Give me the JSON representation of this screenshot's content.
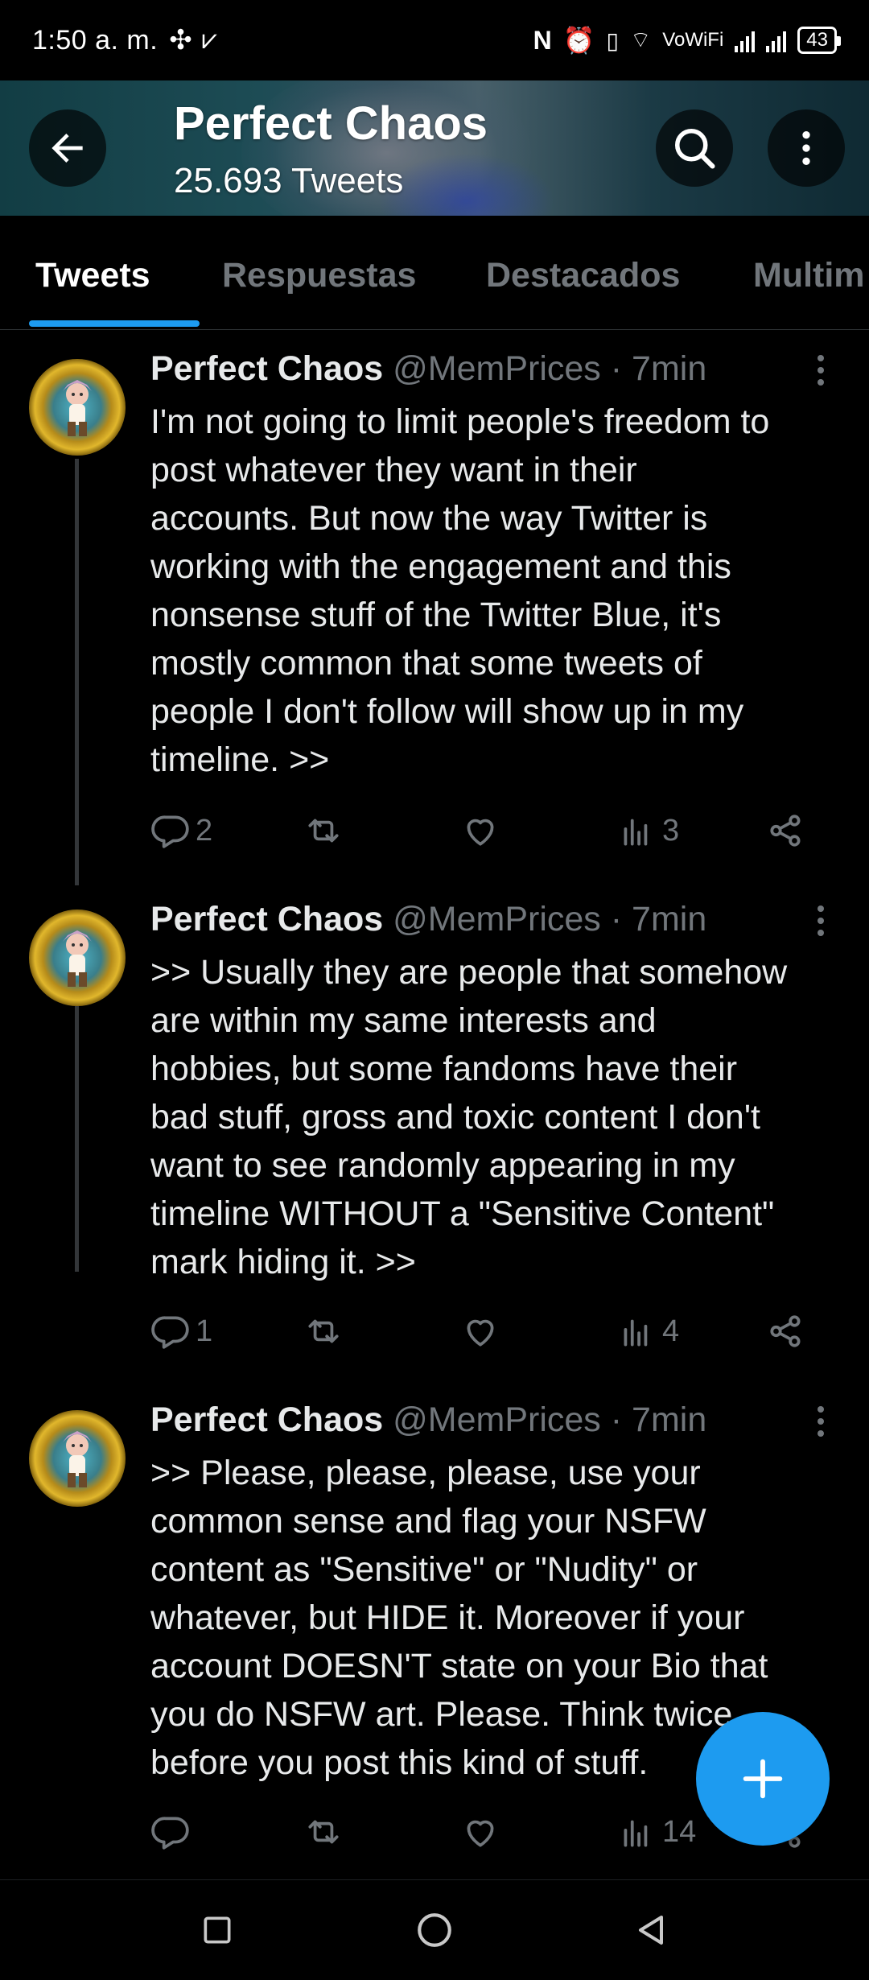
{
  "status_bar": {
    "time": "1:50 a. m.",
    "left_icons": [
      "pinwheel-icon",
      "download-done-icon"
    ],
    "network_label": "VoWiFi",
    "battery": "43"
  },
  "header": {
    "title": "Perfect Chaos",
    "subtitle": "25.693 Tweets"
  },
  "tabs": [
    {
      "label": "Tweets",
      "active": true
    },
    {
      "label": "Respuestas",
      "active": false
    },
    {
      "label": "Destacados",
      "active": false
    },
    {
      "label": "Multim",
      "active": false
    }
  ],
  "tweets": [
    {
      "name": "Perfect Chaos",
      "handle": "@MemPrices",
      "time": "7min",
      "text": "I'm not going to limit people's freedom to\npost whatever they want in their\naccounts. But now the way Twitter is\nworking with the engagement and this\nnonsense stuff of the Twitter Blue, it's\nmostly common that some tweets of\npeople I don't follow will show up in my\ntimeline. >>",
      "replies": "2",
      "retweets": "",
      "likes": "",
      "views": "3"
    },
    {
      "name": "Perfect Chaos",
      "handle": "@MemPrices",
      "time": "7min",
      "text": ">> Usually they are people that somehow\nare within my same interests and\nhobbies, but some fandoms have their\nbad stuff, gross and toxic content I don't\nwant to see randomly appearing in my\ntimeline WITHOUT a \"Sensitive Content\"\nmark hiding it. >>",
      "replies": "1",
      "retweets": "",
      "likes": "",
      "views": "4"
    },
    {
      "name": "Perfect Chaos",
      "handle": "@MemPrices",
      "time": "7min",
      "text": ">> Please, please, please, use your\ncommon sense and flag your NSFW\ncontent as \"Sensitive\" or \"Nudity\" or\nwhatever, but HIDE it. Moreover if your\naccount DOESN'T state on your Bio that\nyou do NSFW art. Please. Think twice\nbefore you post this kind of stuff.",
      "replies": "",
      "retweets": "",
      "likes": "",
      "views": "14"
    }
  ],
  "colors": {
    "accent": "#1d9bf0",
    "muted_text": "#71767b",
    "background": "#000000"
  }
}
